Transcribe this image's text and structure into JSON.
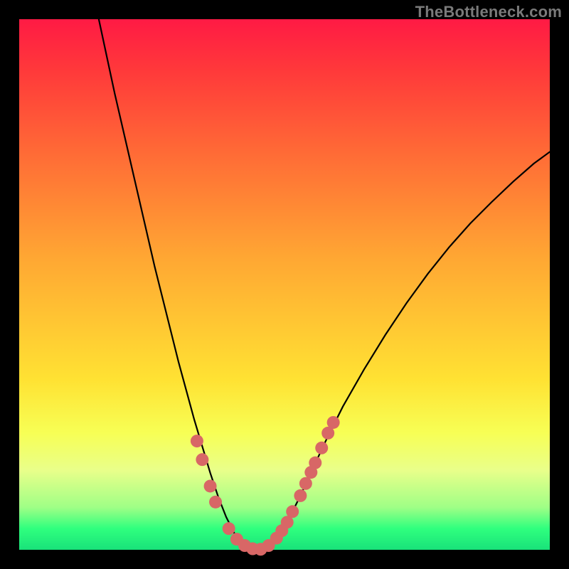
{
  "watermark": "TheBottleneck.com",
  "chart_data": {
    "type": "line",
    "title": "",
    "xlabel": "",
    "ylabel": "",
    "xlim": [
      0,
      100
    ],
    "ylim": [
      0,
      100
    ],
    "series": [
      {
        "name": "curve",
        "color": "#000000",
        "points": [
          {
            "x": 15.0,
            "y": 100.0
          },
          {
            "x": 16.5,
            "y": 93.0
          },
          {
            "x": 18.0,
            "y": 86.0
          },
          {
            "x": 19.5,
            "y": 79.5
          },
          {
            "x": 21.0,
            "y": 73.0
          },
          {
            "x": 22.5,
            "y": 66.5
          },
          {
            "x": 24.0,
            "y": 60.0
          },
          {
            "x": 25.5,
            "y": 53.5
          },
          {
            "x": 27.0,
            "y": 47.5
          },
          {
            "x": 28.5,
            "y": 41.5
          },
          {
            "x": 30.0,
            "y": 35.5
          },
          {
            "x": 31.5,
            "y": 30.0
          },
          {
            "x": 33.0,
            "y": 24.5
          },
          {
            "x": 34.5,
            "y": 19.5
          },
          {
            "x": 36.0,
            "y": 14.5
          },
          {
            "x": 37.5,
            "y": 10.0
          },
          {
            "x": 39.0,
            "y": 6.2
          },
          {
            "x": 40.5,
            "y": 3.2
          },
          {
            "x": 42.0,
            "y": 1.2
          },
          {
            "x": 43.5,
            "y": 0.2
          },
          {
            "x": 45.0,
            "y": 0.0
          },
          {
            "x": 46.5,
            "y": 0.4
          },
          {
            "x": 48.0,
            "y": 1.6
          },
          {
            "x": 49.5,
            "y": 3.6
          },
          {
            "x": 51.0,
            "y": 6.2
          },
          {
            "x": 53.0,
            "y": 10.2
          },
          {
            "x": 55.0,
            "y": 14.6
          },
          {
            "x": 58.0,
            "y": 21.0
          },
          {
            "x": 61.0,
            "y": 27.0
          },
          {
            "x": 65.0,
            "y": 34.0
          },
          {
            "x": 69.0,
            "y": 40.5
          },
          {
            "x": 73.0,
            "y": 46.5
          },
          {
            "x": 77.0,
            "y": 52.0
          },
          {
            "x": 81.0,
            "y": 57.0
          },
          {
            "x": 85.0,
            "y": 61.5
          },
          {
            "x": 89.0,
            "y": 65.5
          },
          {
            "x": 93.0,
            "y": 69.3
          },
          {
            "x": 97.0,
            "y": 72.8
          },
          {
            "x": 100.0,
            "y": 75.0
          }
        ]
      }
    ],
    "markers": [
      {
        "x": 33.5,
        "y": 20.5
      },
      {
        "x": 34.5,
        "y": 17.0
      },
      {
        "x": 36.0,
        "y": 12.0
      },
      {
        "x": 37.0,
        "y": 9.0
      },
      {
        "x": 39.5,
        "y": 4.0
      },
      {
        "x": 41.0,
        "y": 2.0
      },
      {
        "x": 42.5,
        "y": 0.8
      },
      {
        "x": 44.0,
        "y": 0.2
      },
      {
        "x": 45.5,
        "y": 0.1
      },
      {
        "x": 47.0,
        "y": 0.8
      },
      {
        "x": 48.5,
        "y": 2.2
      },
      {
        "x": 49.5,
        "y": 3.6
      },
      {
        "x": 50.5,
        "y": 5.2
      },
      {
        "x": 51.5,
        "y": 7.2
      },
      {
        "x": 53.0,
        "y": 10.2
      },
      {
        "x": 54.0,
        "y": 12.5
      },
      {
        "x": 55.0,
        "y": 14.6
      },
      {
        "x": 55.8,
        "y": 16.4
      },
      {
        "x": 57.0,
        "y": 19.2
      },
      {
        "x": 58.2,
        "y": 22.0
      },
      {
        "x": 59.2,
        "y": 24.0
      }
    ],
    "marker_color": "#d86766",
    "marker_radius_px": 9
  }
}
